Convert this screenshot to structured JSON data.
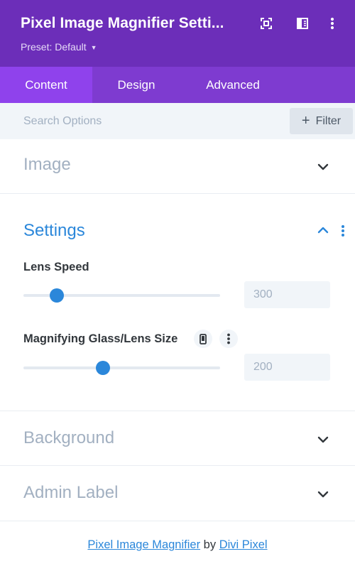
{
  "header": {
    "title": "Pixel Image Magnifier Setti...",
    "preset_label": "Preset: Default",
    "preset_caret": "▼",
    "icons": [
      "fullscreen-icon",
      "sidebar-layout-icon",
      "more-vertical-icon"
    ]
  },
  "tabs": [
    {
      "label": "Content",
      "active": true
    },
    {
      "label": "Design",
      "active": false
    },
    {
      "label": "Advanced",
      "active": false
    }
  ],
  "search": {
    "placeholder": "Search Options",
    "value": "",
    "filter_label": "Filter",
    "filter_icon": "+"
  },
  "sections": {
    "image": {
      "title": "Image",
      "expanded": false
    },
    "settings": {
      "title": "Settings",
      "expanded": true,
      "fields": [
        {
          "label": "Lens Speed",
          "value": "300",
          "slider_fraction": 0.17
        },
        {
          "label": "Magnifying Glass/Lens Size",
          "value": "200",
          "slider_fraction": 0.405,
          "icons": [
            "phone-icon",
            "more-vertical-icon"
          ]
        }
      ]
    },
    "background": {
      "title": "Background",
      "expanded": false
    },
    "admin_label": {
      "title": "Admin Label",
      "expanded": false
    }
  },
  "footer": {
    "link1": "Pixel Image Magnifier",
    "by": "by",
    "link2": "Divi Pixel"
  },
  "colors": {
    "header_bg": "#6c2eb9",
    "tabs_bg": "#7e3bd0",
    "active_tab_bg": "#8f42ec",
    "accent_blue": "#2b87da",
    "muted_text": "#a2b0c1",
    "panel_bg": "#f1f5f9"
  }
}
